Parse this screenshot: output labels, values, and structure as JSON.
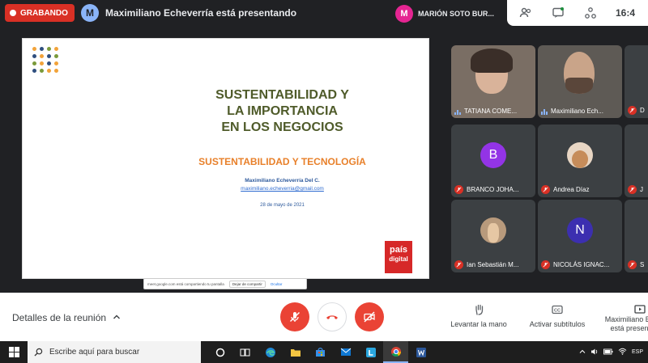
{
  "topbar": {
    "recording_label": "GRABANDO",
    "presenter_initial": "M",
    "presenter_text": "Maximiliano Echeverría está presentando",
    "pinned_user_initial": "M",
    "pinned_user_name": "MARIÓN SOTO BUR...",
    "clock": "16:4"
  },
  "slide": {
    "title_lines": [
      "SUSTENTABILIDAD Y",
      "LA IMPORTANCIA",
      "EN LOS NEGOCIOS"
    ],
    "subtitle": "SUSTENTABILIDAD Y TECNOLOGÍA",
    "author": "Maximiliano Echeverría Del C.",
    "email": "maximiliano.echeverria@gmail.com",
    "date": "28 de mayo de 2021",
    "logo_line1": "país",
    "logo_line2": "digital",
    "dot_colors": [
      "#f2a33a",
      "#2f4f7f",
      "#7a9a3a",
      "#f2a33a",
      "#2f4f7f",
      "#f2a33a",
      "#2f4f7f",
      "#7a9a3a",
      "#7a9a3a",
      "#f2a33a",
      "#2f4f7f",
      "#f2a33a",
      "#2f4f7f",
      "#7a9a3a",
      "#f2a33a",
      "#f2a33a"
    ]
  },
  "share_bar": {
    "text": "meet.google.com está compartiendo tu pantalla",
    "stop_label": "Dejar de compartir",
    "hide_label": "Ocultar"
  },
  "participants": [
    {
      "name": "TATIANA COME...",
      "type": "video",
      "speaking": true
    },
    {
      "name": "Maximiliano Ech...",
      "type": "video",
      "speaking": true
    },
    {
      "name": "D",
      "type": "partial"
    },
    {
      "name": "BRANCO JOHA...",
      "type": "avatar",
      "initial": "B",
      "color": "#9334e6"
    },
    {
      "name": "Andrea Díaz",
      "type": "photo"
    },
    {
      "name": "J",
      "type": "partial"
    },
    {
      "name": "Ian Sebastián M...",
      "type": "photo"
    },
    {
      "name": "NICOLÁS IGNAC...",
      "type": "avatar",
      "initial": "N",
      "color": "#3c2fb0"
    },
    {
      "name": "S",
      "type": "partial"
    }
  ],
  "controls": {
    "meeting_details": "Detalles de la reunión",
    "raise_hand": "Levantar la mano",
    "captions": "Activar subtítulos",
    "presenting_line1": "Maximiliano Ec",
    "presenting_line2": "está presen"
  },
  "taskbar": {
    "search_placeholder": "Escribe aquí para buscar",
    "language": "ESP"
  },
  "colors": {
    "meet_red": "#ea4335",
    "recording_red": "#d93025",
    "background": "#202124"
  }
}
